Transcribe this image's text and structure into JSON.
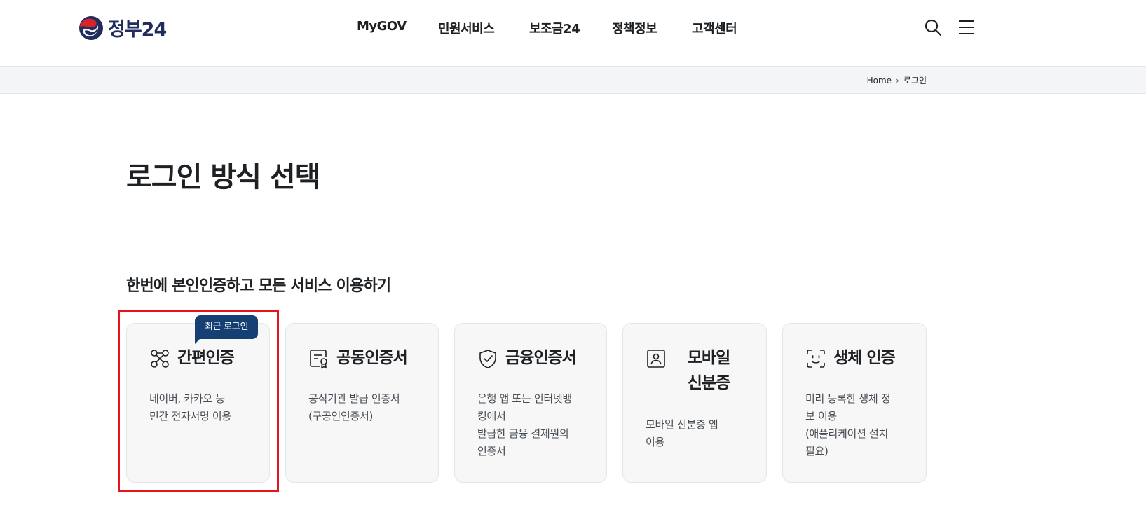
{
  "header": {
    "logo_text": "정부24",
    "nav": [
      "MyGOV",
      "민원서비스",
      "보조금24",
      "정책정보",
      "고객센터"
    ],
    "icons": [
      "search-icon",
      "hamburger-menu-icon"
    ]
  },
  "breadcrumb": {
    "home": "Home",
    "separator": "›",
    "current": "로그인"
  },
  "page_title": "로그인 방식 선택",
  "section_title": "한번에 본인인증하고 모든 서비스 이용하기",
  "recent_badge": "최근 로그인",
  "cards": [
    {
      "icon": "simple-auth-icon",
      "title": "간편인증",
      "desc": [
        "네이버, 카카오 등",
        "민간 전자서명 이용"
      ]
    },
    {
      "icon": "certificate-icon",
      "title": "공동인증서",
      "desc": [
        "공식기관 발급 인증서",
        "(구공인인증서)"
      ]
    },
    {
      "icon": "shield-check-icon",
      "title": "금융인증서",
      "desc": [
        "은행 앱 또는 인터넷뱅",
        "킹에서",
        "발급한 금융 결제원의",
        "인증서"
      ]
    },
    {
      "icon": "mobile-id-icon",
      "title_lines": [
        "모바일",
        "신분증"
      ],
      "desc": [
        "모바일 신분증 앱",
        "이용"
      ]
    },
    {
      "icon": "face-scan-icon",
      "title": "생체 인증",
      "desc": [
        "미리 등록한 생체 정",
        "보 이용",
        "(애플리케이션 설치",
        "필요)"
      ]
    }
  ],
  "colors": {
    "brand_navy": "#163f73",
    "highlight_red": "#e8141c",
    "card_bg": "#f7f7f7"
  }
}
